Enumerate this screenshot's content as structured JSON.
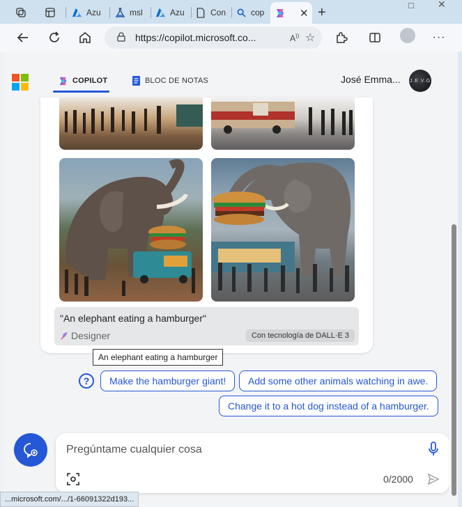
{
  "browser": {
    "tabs": [
      {
        "label": "",
        "icon": "workspaces-icon"
      },
      {
        "label": "",
        "icon": "tab-actions-icon"
      },
      {
        "label": "Azu",
        "icon": "azure-icon"
      },
      {
        "label": "msl",
        "icon": "flask-icon"
      },
      {
        "label": "Azu",
        "icon": "azure-icon"
      },
      {
        "label": "Con",
        "icon": "page-icon"
      },
      {
        "label": "cop",
        "icon": "search-icon"
      },
      {
        "label": "",
        "icon": "copilot-icon",
        "active": true
      }
    ],
    "url": "https://copilot.microsoft.co...",
    "status_url": "...microsoft.com/.../1-66091322d193..."
  },
  "header": {
    "tabs": [
      {
        "label": "COPILOT",
        "active": true
      },
      {
        "label": "BLOC DE NOTAS",
        "active": false
      }
    ],
    "user_name": "José Emma...",
    "avatar_text": "J.E.V.G"
  },
  "image_card": {
    "caption": "\"An elephant eating a hamburger\"",
    "designer": "Designer",
    "badge": "Con tecnología de DALL·E 3",
    "tooltip": "An elephant eating a hamburger"
  },
  "suggestions": [
    "Make the hamburger giant!",
    "Add some other animals watching in awe.",
    "Change it to a hot dog instead of a hamburger."
  ],
  "composer": {
    "placeholder": "Pregúntame cualquier cosa",
    "counter": "0/2000"
  },
  "colors": {
    "accent": "#2557d6",
    "page_bg": "#f3f4f6"
  }
}
